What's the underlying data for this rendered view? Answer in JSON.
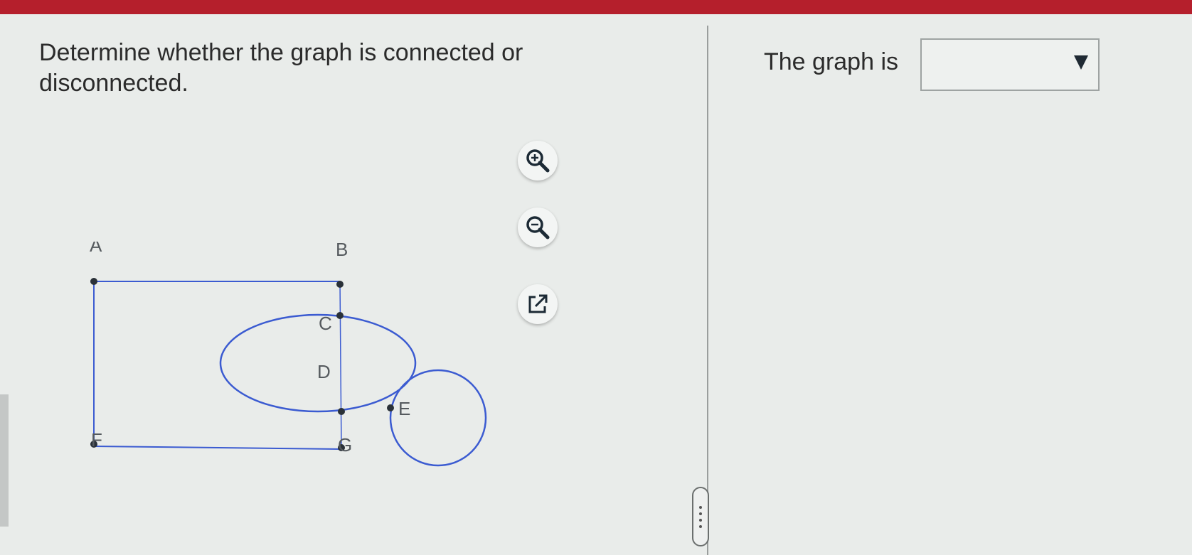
{
  "question": {
    "line1": "Determine whether the graph is connected or",
    "line2": "disconnected."
  },
  "answer": {
    "prefix": "The graph is",
    "selected_value": ""
  },
  "graph": {
    "vertices": [
      "A",
      "B",
      "C",
      "D",
      "E",
      "F",
      "G"
    ]
  },
  "tools": {
    "zoom_in": "zoom-in-icon",
    "zoom_out": "zoom-out-icon",
    "open_new": "open-external-icon"
  },
  "colors": {
    "top_bar": "#b51f2c",
    "edge": "#3b5bd1",
    "vertex": "#2a3138"
  }
}
